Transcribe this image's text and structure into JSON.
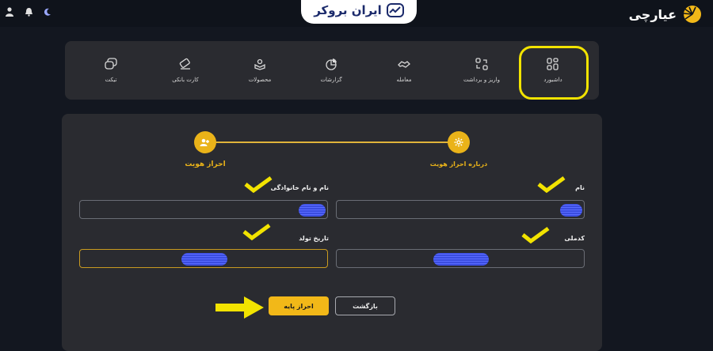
{
  "brand": {
    "name": "عیارچی",
    "color": "#f2b818"
  },
  "watermark": {
    "text": "ایران بروکر"
  },
  "topbar_icons": [
    "user-icon",
    "bell-icon",
    "moon-icon"
  ],
  "menu": {
    "items": [
      {
        "label": "داشبورد",
        "icon": "grid-icon"
      },
      {
        "label": "واریز و برداشت",
        "icon": "transfer-icon"
      },
      {
        "label": "معامله",
        "icon": "handshake-icon"
      },
      {
        "label": "گزارشات",
        "icon": "pie-chart-icon"
      },
      {
        "label": "محصولات",
        "icon": "box-icon"
      },
      {
        "label": "کارت بانکی",
        "icon": "card-icon"
      },
      {
        "label": "تیکت",
        "icon": "chat-icon"
      }
    ]
  },
  "stepper": {
    "step1": "درباره احراز هویت",
    "step2": "احراز هویت"
  },
  "form": {
    "first_name_label": "نام",
    "full_name_label": "نام و نام خانوادگی",
    "national_code_label": "کدملی",
    "birth_date_label": "تاریخ تولد"
  },
  "buttons": {
    "back": "بازگشت",
    "basic_auth": "احراز پایه"
  },
  "colors": {
    "accent": "#eab319",
    "annotation": "#f2e300",
    "background": "#131720",
    "panel": "#2a2b30"
  }
}
